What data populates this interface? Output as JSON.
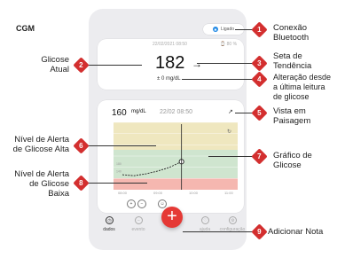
{
  "app": {
    "title": "CGM"
  },
  "bluetooth": {
    "status": "Ligado"
  },
  "current": {
    "timestamp": "22/02/2021 08:50",
    "battery": "80 %",
    "value": "182",
    "trend_arrow": "→",
    "delta": "± 0 mg/dL"
  },
  "chart_card": {
    "value": "160",
    "unit": "mg/dL",
    "time": "22/02 08:50",
    "expand_icon": "↗"
  },
  "chart_data": {
    "type": "line",
    "x": [
      "08:00",
      "08:20",
      "08:40",
      "09:00",
      "09:20",
      "09:40",
      "10:00",
      "10:20",
      "10:40",
      "11:00"
    ],
    "series": [
      {
        "values": [
          120,
          115,
          125,
          140,
          160,
          190,
          null,
          null,
          null,
          null
        ]
      }
    ],
    "current_point": {
      "x": "09:40",
      "y": 190
    },
    "xlabel": "",
    "ylabel": "",
    "ylim": [
      40,
      400
    ],
    "x_tick_labels": [
      "08:00",
      "09:00",
      "10:00",
      "11:00"
    ],
    "y_tick_labels": [
      "180",
      "140"
    ],
    "bands": [
      {
        "name": "high",
        "color": "#efe7bf"
      },
      {
        "name": "target",
        "color": "#cfe5cf"
      },
      {
        "name": "low",
        "color": "#f5b7b0"
      }
    ],
    "grid": true
  },
  "bottom_nav": {
    "items": [
      {
        "label": "dados",
        "active": true
      },
      {
        "label": "evento",
        "active": false
      },
      {
        "label": "ajuda",
        "active": false
      },
      {
        "label": "configuração",
        "active": false
      }
    ]
  },
  "callouts": [
    {
      "number": "1",
      "text": "Conexão\nBluetooth"
    },
    {
      "number": "2",
      "text": "Glicose\nAtual"
    },
    {
      "number": "3",
      "text": "Seta de\nTendência"
    },
    {
      "number": "4",
      "text": "Alteração desde\na última leitura\nde glicose"
    },
    {
      "number": "5",
      "text": "Vista em\nPaisagem"
    },
    {
      "number": "6",
      "text": "Nível de Alerta\nde Glicose Alta"
    },
    {
      "number": "7",
      "text": "Gráfico de\nGlicose"
    },
    {
      "number": "8",
      "text": "Nível de Alerta\nde Glicose\nBaixa"
    },
    {
      "number": "9",
      "text": "Adicionar Nota"
    }
  ],
  "colors": {
    "accent": "#e53935",
    "marker": "#d32f2f",
    "bluetooth": "#1e88e5"
  }
}
